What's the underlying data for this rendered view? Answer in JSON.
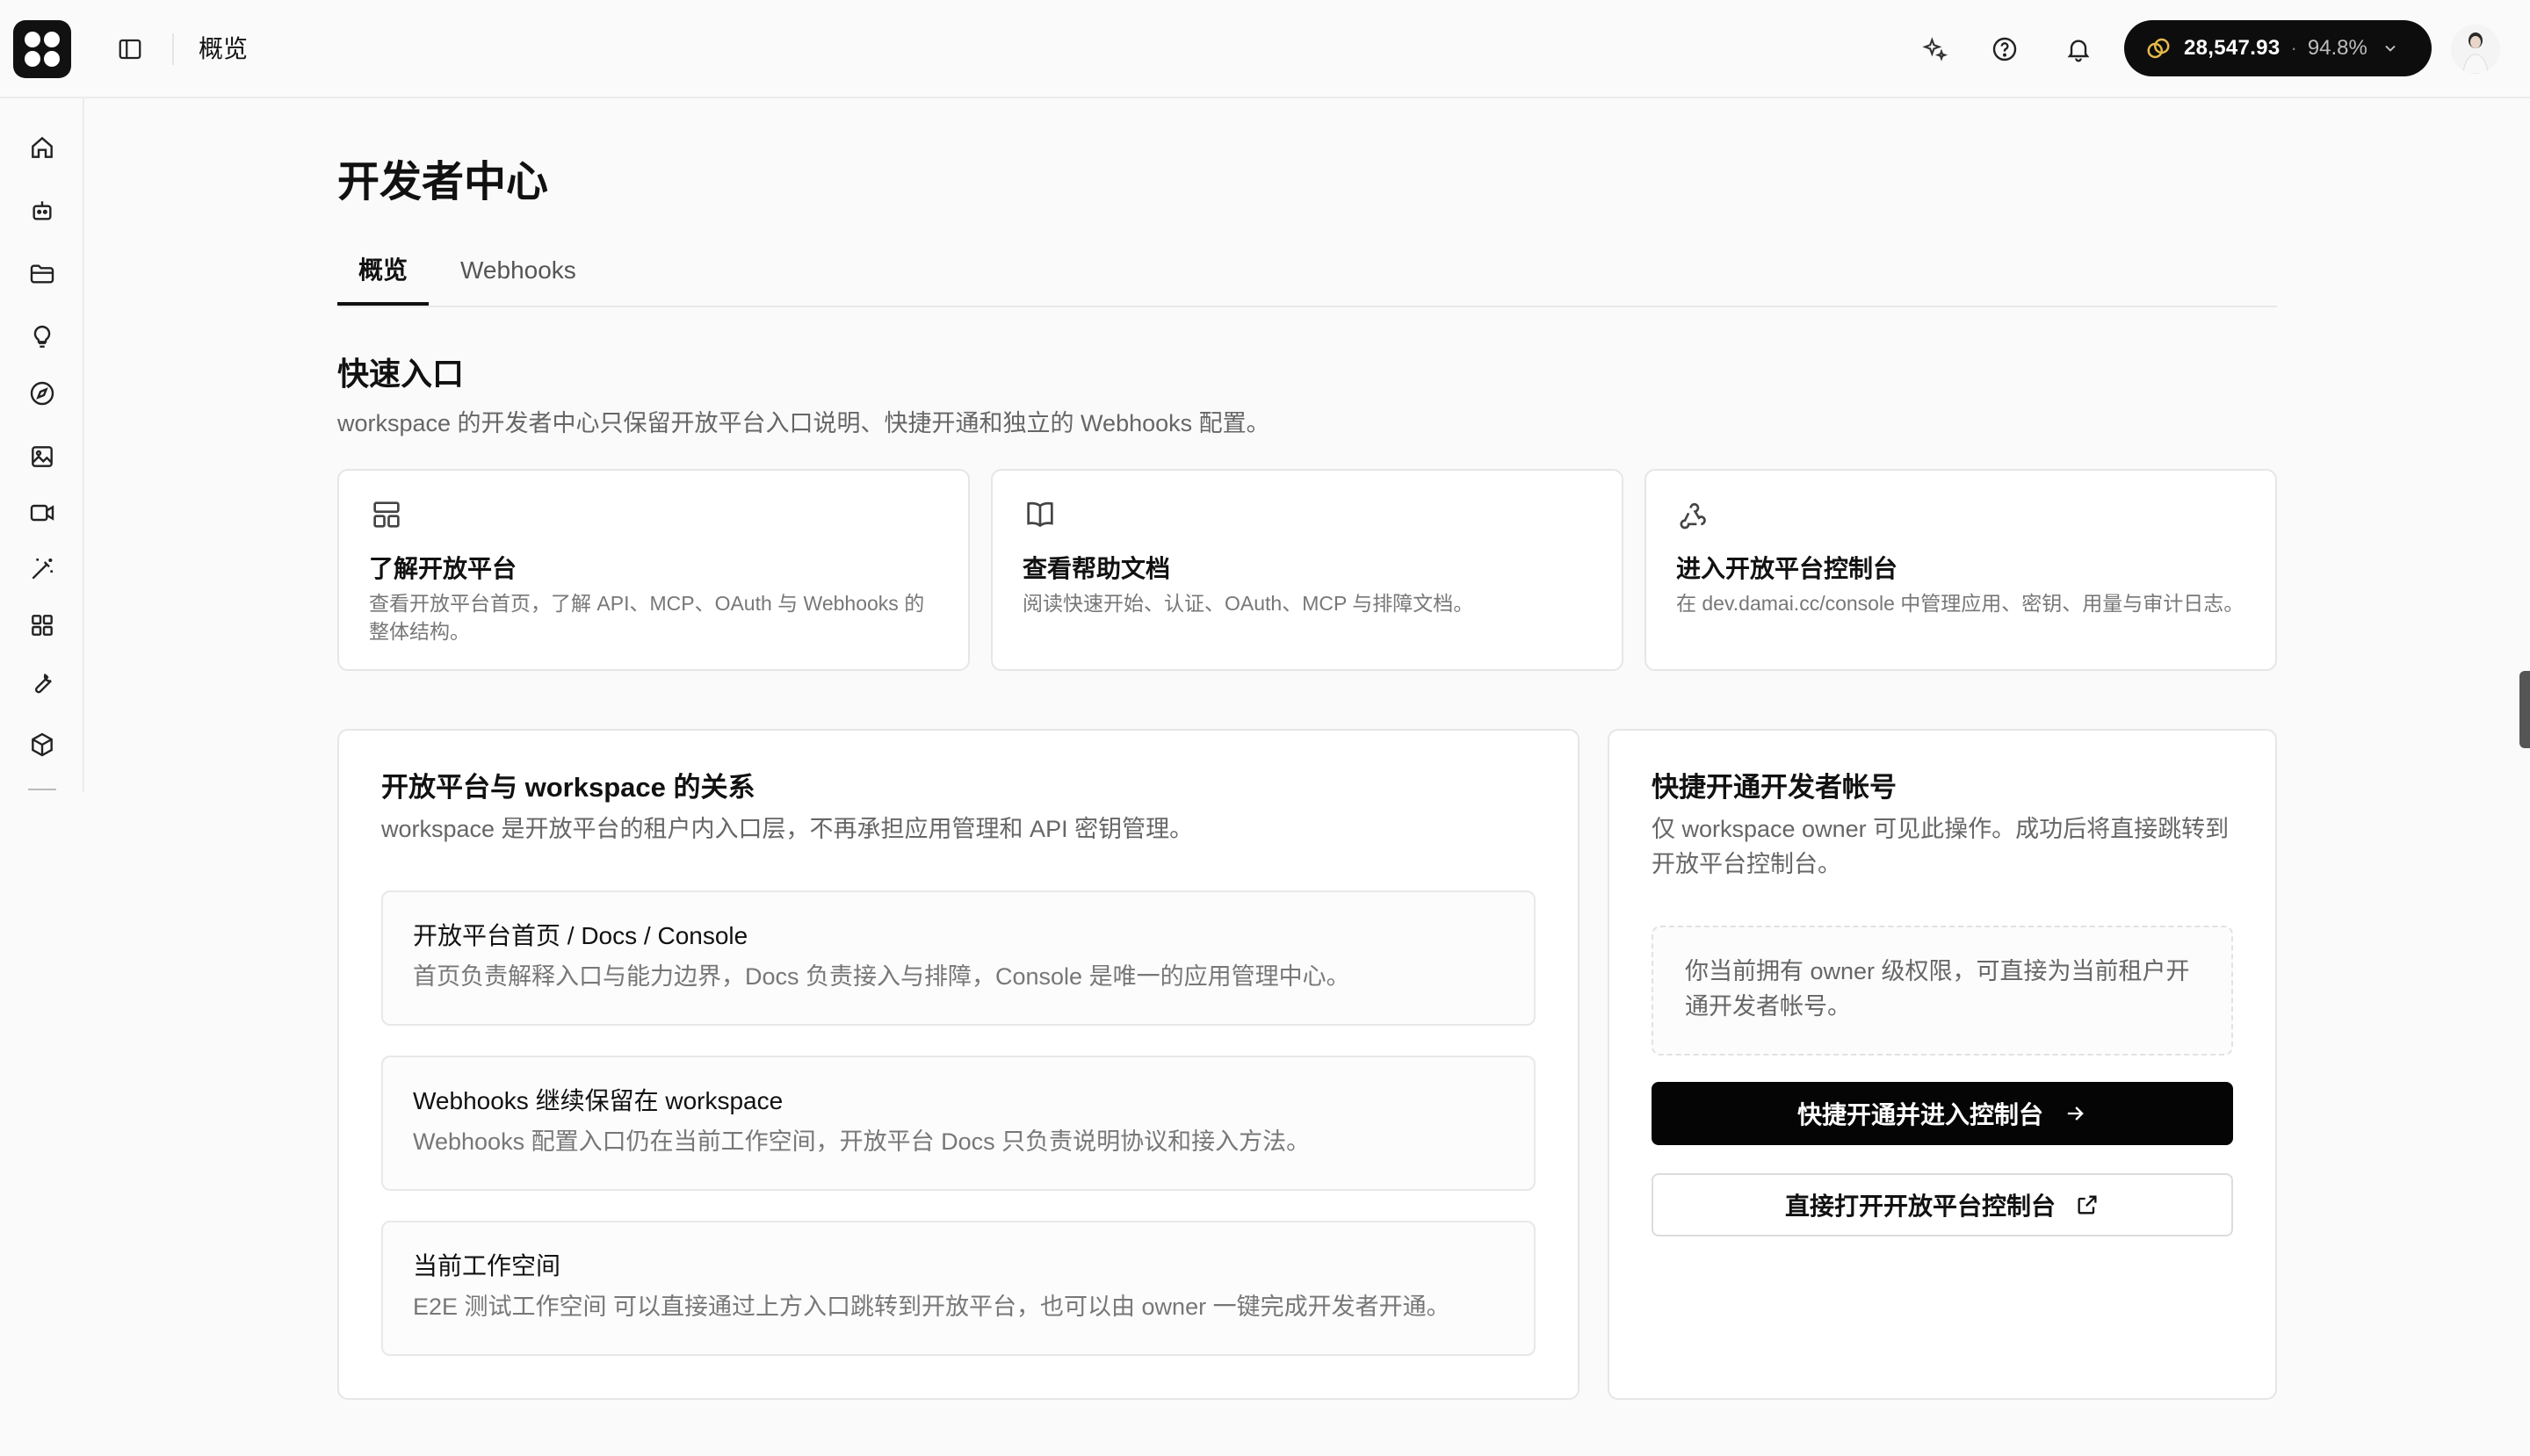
{
  "topbar": {
    "title": "概览",
    "credits": {
      "amount": "28,547.93",
      "separator": "·",
      "percent": "94.8%"
    }
  },
  "icons": {
    "logo": "brand-logo",
    "sidebar_toggle": "sidebar-panel-icon",
    "sparkle": "sparkle-icon",
    "help": "help-circle-icon",
    "bell": "bell-icon",
    "coin": "coin-icon",
    "chevron": "chevron-down-icon"
  },
  "sidebar": {
    "items": [
      {
        "name": "home-icon"
      },
      {
        "name": "bot-icon"
      },
      {
        "name": "folder-icon"
      },
      {
        "name": "lightbulb-icon"
      },
      {
        "name": "compass-icon"
      },
      {
        "name": "image-icon"
      },
      {
        "name": "video-icon"
      },
      {
        "name": "magic-wand-icon"
      },
      {
        "name": "apps-grid-icon"
      },
      {
        "name": "wrench-icon"
      },
      {
        "name": "package-icon"
      }
    ]
  },
  "main": {
    "page_title": "开发者中心",
    "tabs": [
      {
        "label": "概览",
        "active": true
      },
      {
        "label": "Webhooks",
        "active": false
      }
    ],
    "quick": {
      "title": "快速入口",
      "subtitle": "workspace 的开发者中心只保留开放平台入口说明、快捷开通和独立的 Webhooks 配置。",
      "cards": [
        {
          "icon": "layout-icon",
          "title": "了解开放平台",
          "desc": "查看开放平台首页，了解 API、MCP、OAuth 与 Webhooks 的整体结构。"
        },
        {
          "icon": "book-icon",
          "title": "查看帮助文档",
          "desc": "阅读快速开始、认证、OAuth、MCP 与排障文档。"
        },
        {
          "icon": "webhook-icon",
          "title": "进入开放平台控制台",
          "desc": "在 dev.damai.cc/console 中管理应用、密钥、用量与审计日志。"
        }
      ]
    },
    "relation": {
      "title": "开放平台与 workspace 的关系",
      "subtitle": "workspace 是开放平台的租户内入口层，不再承担应用管理和 API 密钥管理。",
      "items": [
        {
          "title": "开放平台首页 / Docs / Console",
          "desc": "首页负责解释入口与能力边界，Docs 负责接入与排障，Console 是唯一的应用管理中心。"
        },
        {
          "title": "Webhooks 继续保留在 workspace",
          "desc": "Webhooks 配置入口仍在当前工作空间，开放平台 Docs 只负责说明协议和接入方法。"
        },
        {
          "title": "当前工作空间",
          "desc": "E2E 测试工作空间 可以直接通过上方入口跳转到开放平台，也可以由 owner 一键完成开发者开通。"
        }
      ]
    },
    "activate": {
      "title": "快捷开通开发者帐号",
      "subtitle": "仅 workspace owner 可见此操作。成功后将直接跳转到开放平台控制台。",
      "note": "你当前拥有 owner 级权限，可直接为当前租户开通开发者帐号。",
      "primary_button": "快捷开通并进入控制台",
      "secondary_button": "直接打开开放平台控制台"
    }
  }
}
